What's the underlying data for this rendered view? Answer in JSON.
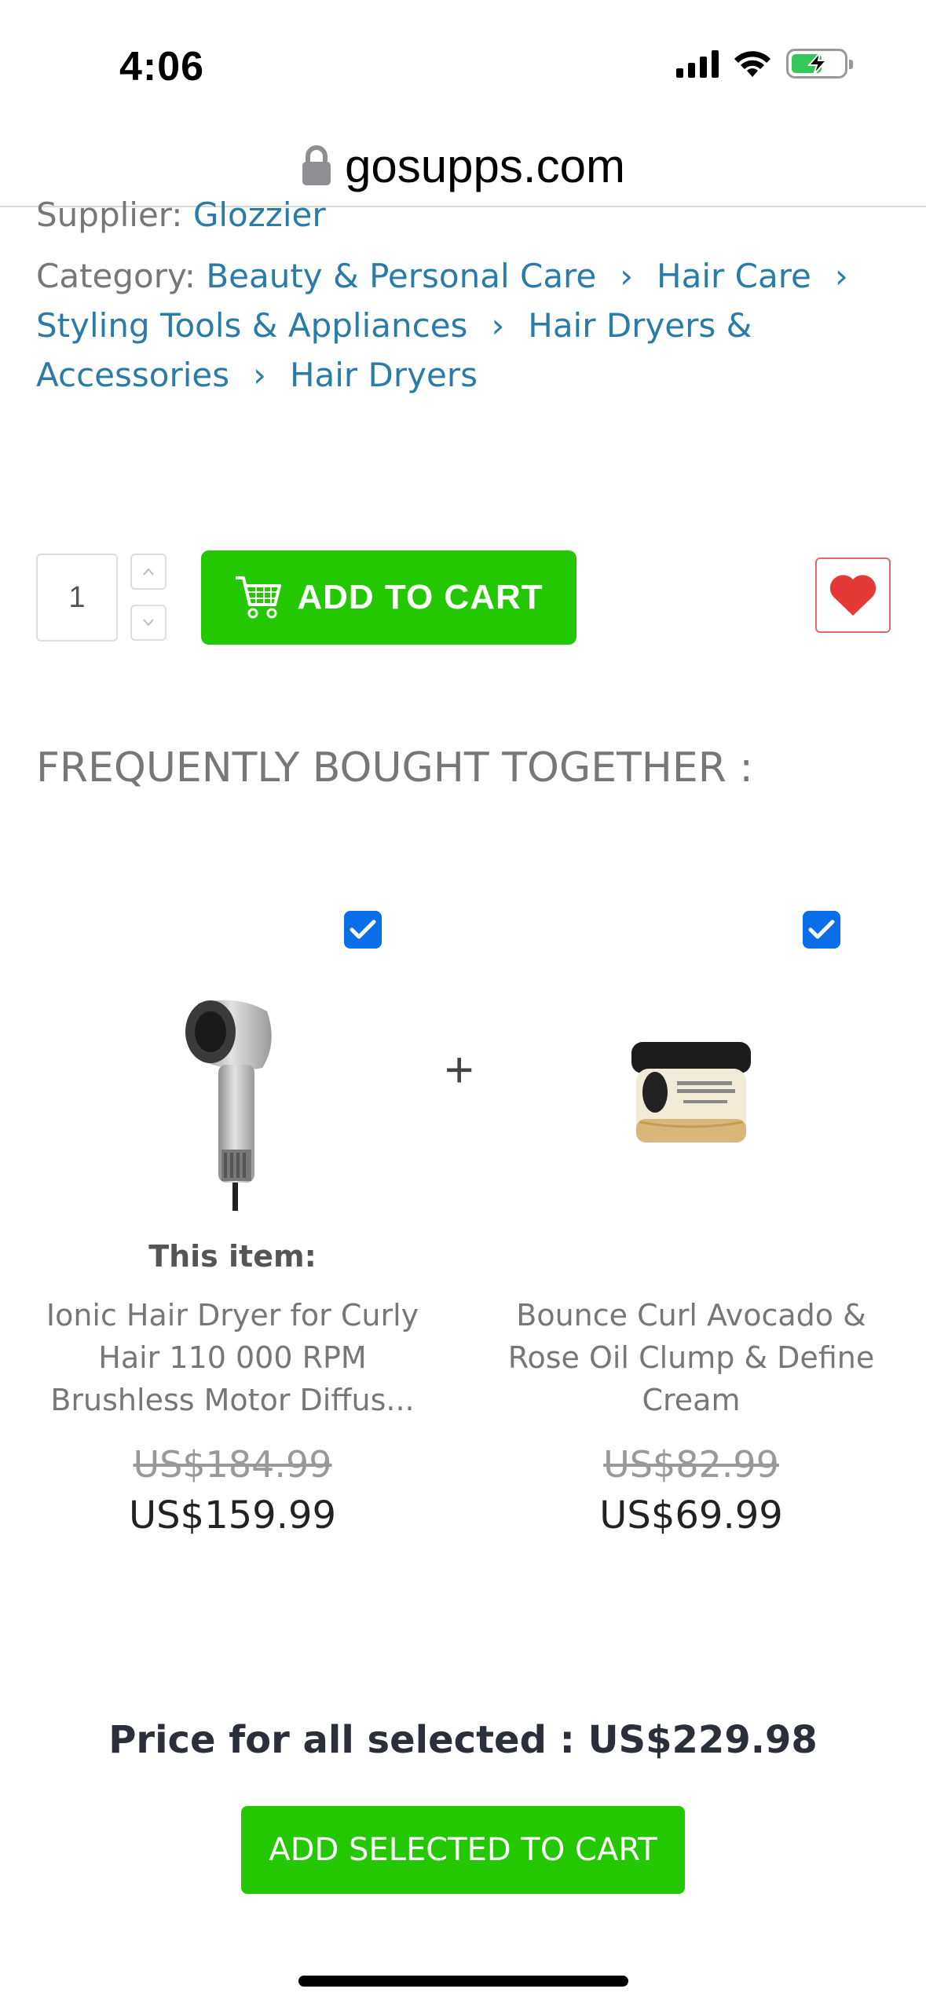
{
  "status_bar": {
    "time": "4:06"
  },
  "browser": {
    "url": "gosupps.com"
  },
  "product": {
    "supplier_label": "Supplier:",
    "supplier_value": "Glozzier",
    "category_label": "Category:",
    "categories": [
      "Beauty & Personal Care",
      "Hair Care",
      "Styling Tools & Appliances",
      "Hair Dryers & Accessories",
      "Hair Dryers"
    ],
    "separator": "›"
  },
  "purchase": {
    "quantity": "1",
    "add_to_cart_label": "ADD TO CART"
  },
  "fbt": {
    "title": "FREQUENTLY BOUGHT TOGETHER :",
    "this_item_label": "This item:",
    "plus": "+",
    "items": [
      {
        "name": "Ionic Hair Dryer for Curly Hair 110 000 RPM Brushless Motor Diffus...",
        "old_price": "US$184.99",
        "price": "US$159.99",
        "checked": true
      },
      {
        "name": "Bounce Curl Avocado & Rose Oil Clump & Define Cream",
        "old_price": "US$82.99",
        "price": "US$69.99",
        "checked": true
      }
    ],
    "total_label": "Price for all selected : US$229.98",
    "add_selected_label": "ADD SELECTED TO CART"
  },
  "colors": {
    "accent_green": "#23c800",
    "link_blue": "#2a7ba7",
    "checkbox_blue": "#0a6ee8",
    "heart_red": "#e53935"
  }
}
